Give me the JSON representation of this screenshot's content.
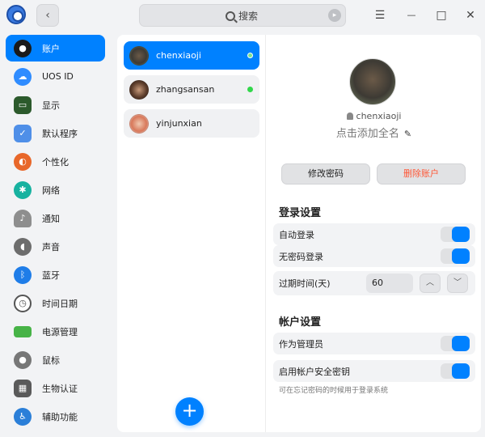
{
  "titlebar": {
    "search_placeholder": "搜索",
    "back_icon": "‹",
    "menu_icon": "☰",
    "minimize_icon": "—",
    "maximize_icon": "□",
    "close_icon": "✕"
  },
  "sidebar": {
    "items": [
      {
        "label": "账户",
        "icon": "account-icon",
        "color": "#1a1a1a"
      },
      {
        "label": "UOS ID",
        "icon": "cloud-icon",
        "color": "#2f8cff"
      },
      {
        "label": "显示",
        "icon": "display-icon",
        "color": "#2c5a2c"
      },
      {
        "label": "默认程序",
        "icon": "default-apps-icon",
        "color": "#4f8fe8"
      },
      {
        "label": "个性化",
        "icon": "personalization-icon",
        "color": "#e8672a"
      },
      {
        "label": "网络",
        "icon": "network-icon",
        "color": "#17b2a0"
      },
      {
        "label": "通知",
        "icon": "bell-icon",
        "color": "#8e8e8e"
      },
      {
        "label": "声音",
        "icon": "speaker-icon",
        "color": "#6d6d6d"
      },
      {
        "label": "蓝牙",
        "icon": "bluetooth-icon",
        "color": "#1f7de8"
      },
      {
        "label": "时间日期",
        "icon": "clock-icon",
        "color": "#555555"
      },
      {
        "label": "电源管理",
        "icon": "battery-icon",
        "color": "#47b347"
      },
      {
        "label": "鼠标",
        "icon": "mouse-icon",
        "color": "#777777"
      },
      {
        "label": "生物认证",
        "icon": "fingerprint-icon",
        "color": "#5a5a5a"
      },
      {
        "label": "辅助功能",
        "icon": "accessibility-icon",
        "color": "#2b7fd8"
      }
    ]
  },
  "accounts": [
    {
      "name": "chenxiaoji",
      "online": true
    },
    {
      "name": "zhangsansan",
      "online": true
    },
    {
      "name": "yinjunxian",
      "online": false
    }
  ],
  "add_icon": "+",
  "detail": {
    "username": "chenxiaoji",
    "fullname_placeholder": "点击添加全名",
    "change_password": "修改密码",
    "delete_account": "删除账户",
    "login_settings_title": "登录设置",
    "auto_login": "自动登录",
    "passwordless_login": "无密码登录",
    "expire_label": "过期时间(天)",
    "expire_value": "60",
    "account_settings_title": "帐户设置",
    "as_admin": "作为管理员",
    "enable_security_key": "启用帐户安全密钥",
    "hint": "可在忘记密码的时候用于登录系统",
    "pencil_icon": "✎",
    "up_icon": "︿",
    "down_icon": "﹀"
  }
}
